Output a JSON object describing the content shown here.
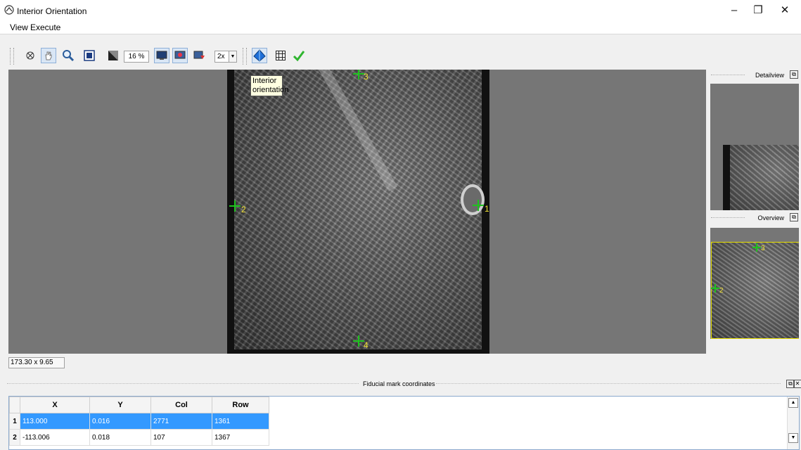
{
  "window": {
    "title": "Interior Orientation",
    "controls": {
      "minimize": "–",
      "restore": "❐",
      "close": "✕"
    }
  },
  "menu": [
    {
      "label": "View"
    },
    {
      "label": "Execute"
    }
  ],
  "toolbar": {
    "zoom_value": "16 %",
    "magnification": "2x",
    "tooltip": "Interior orientation",
    "icons": [
      "cancel-tool-icon",
      "pan-hand-icon",
      "zoom-magnifier-icon",
      "fit-to-window-icon",
      "contrast-icon",
      "monitor-icon",
      "network-icon",
      "save-icon",
      "interior-orientation-icon",
      "grid-icon",
      "checkmark-icon"
    ],
    "accent_colors": {
      "check": "#2fb52f",
      "orientation": "#1e6fd9"
    }
  },
  "main_view": {
    "fiducial_marks": [
      {
        "label": "1"
      },
      {
        "label": "2"
      },
      {
        "label": "3"
      },
      {
        "label": "4"
      }
    ],
    "fiducial_color": "#1ec21e",
    "label_color": "#f1e234"
  },
  "panels": {
    "detail": {
      "title": "Detailview"
    },
    "overview": {
      "title": "Overview",
      "marks": [
        "3",
        "2"
      ]
    }
  },
  "status": {
    "coordinates": "173.30 x 9.65"
  },
  "fiducial_table": {
    "title": "Fiducial mark coordinates",
    "columns": [
      "X",
      "Y",
      "Col",
      "Row"
    ],
    "rows": [
      {
        "index": "1",
        "x": "113.000",
        "y": "0.016",
        "col": "2771",
        "row": "1361",
        "selected": true
      },
      {
        "index": "2",
        "x": "-113.006",
        "y": "0.018",
        "col": "107",
        "row": "1367",
        "selected": false
      }
    ]
  }
}
